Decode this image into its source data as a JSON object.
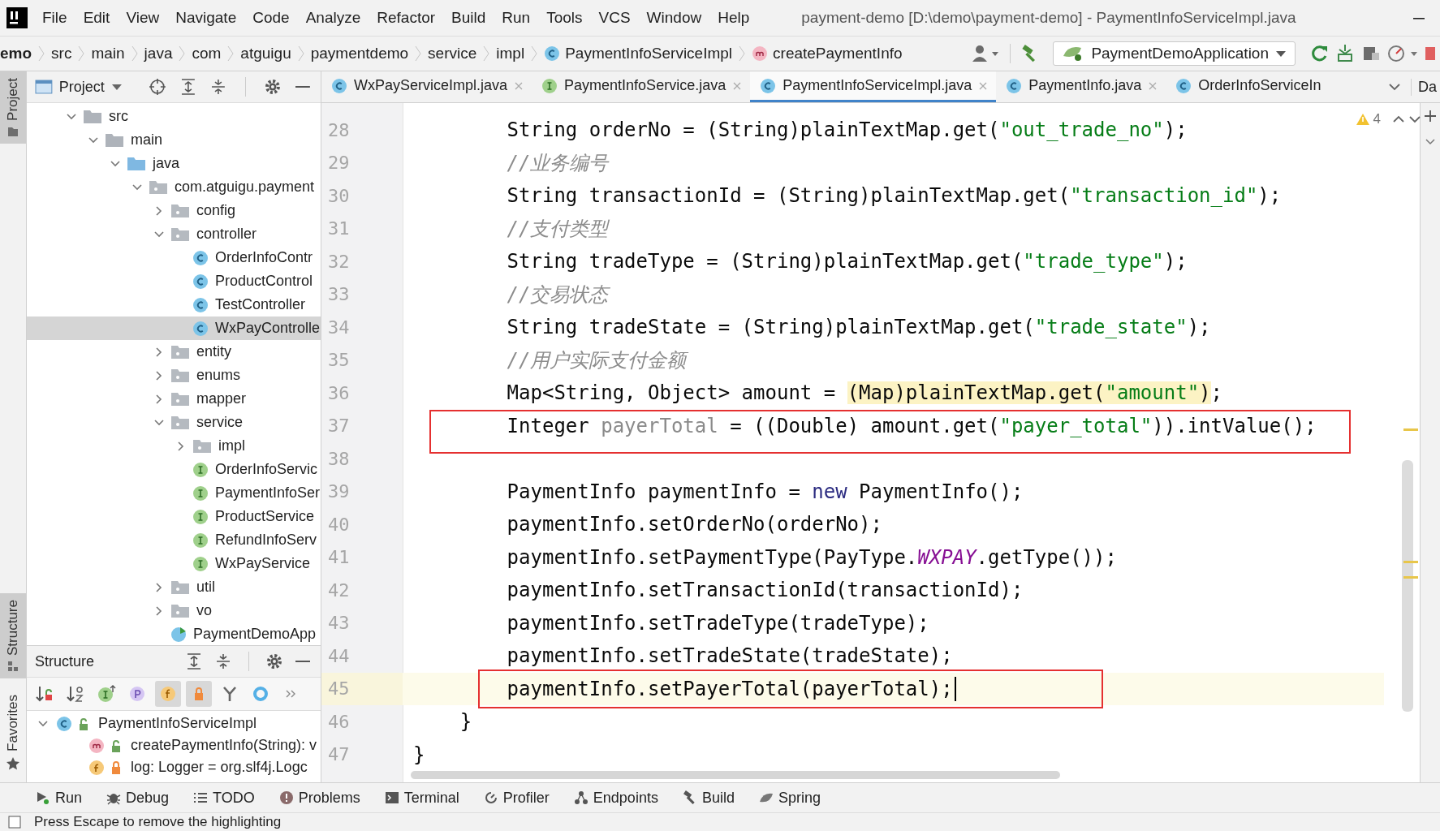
{
  "window": {
    "title": "payment-demo [D:\\demo\\payment-demo] - PaymentInfoServiceImpl.java"
  },
  "menu": [
    "File",
    "Edit",
    "View",
    "Navigate",
    "Code",
    "Analyze",
    "Refactor",
    "Build",
    "Run",
    "Tools",
    "VCS",
    "Window",
    "Help"
  ],
  "breadcrumbs": [
    {
      "label": "emo",
      "kind": "project"
    },
    {
      "label": "src",
      "kind": "dir"
    },
    {
      "label": "main",
      "kind": "dir"
    },
    {
      "label": "java",
      "kind": "dir"
    },
    {
      "label": "com",
      "kind": "dir"
    },
    {
      "label": "atguigu",
      "kind": "dir"
    },
    {
      "label": "paymentdemo",
      "kind": "dir"
    },
    {
      "label": "service",
      "kind": "dir"
    },
    {
      "label": "impl",
      "kind": "dir"
    },
    {
      "label": "PaymentInfoServiceImpl",
      "kind": "class"
    },
    {
      "label": "createPaymentInfo",
      "kind": "method"
    }
  ],
  "run_config": {
    "label": "PaymentDemoApplication"
  },
  "tool_strip": [
    {
      "label": "Project",
      "kind": "project",
      "selected": true
    },
    {
      "label": "Structure",
      "kind": "structure",
      "selected": true
    },
    {
      "label": "Favorites",
      "kind": "favorites",
      "selected": false
    }
  ],
  "project_panel": {
    "title": "Project"
  },
  "project_tree": [
    {
      "label": "src",
      "kind": "folder",
      "expanded": true,
      "selected": false,
      "children": [
        {
          "label": "main",
          "kind": "folder",
          "expanded": true,
          "selected": false,
          "children": [
            {
              "label": "java",
              "kind": "source-folder",
              "expanded": true,
              "selected": false,
              "children": [
                {
                  "label": "com.atguigu.payment",
                  "kind": "package",
                  "expanded": true,
                  "selected": false,
                  "children": [
                    {
                      "label": "config",
                      "kind": "package",
                      "expanded": false,
                      "selected": false
                    },
                    {
                      "label": "controller",
                      "kind": "package",
                      "expanded": true,
                      "selected": false,
                      "children": [
                        {
                          "label": "OrderInfoContr",
                          "kind": "class",
                          "selected": false
                        },
                        {
                          "label": "ProductControl",
                          "kind": "class",
                          "selected": false
                        },
                        {
                          "label": "TestController",
                          "kind": "class",
                          "selected": false
                        },
                        {
                          "label": "WxPayControlle",
                          "kind": "class",
                          "selected": true
                        }
                      ]
                    },
                    {
                      "label": "entity",
                      "kind": "package",
                      "expanded": false,
                      "selected": false
                    },
                    {
                      "label": "enums",
                      "kind": "package",
                      "expanded": false,
                      "selected": false
                    },
                    {
                      "label": "mapper",
                      "kind": "package",
                      "expanded": false,
                      "selected": false
                    },
                    {
                      "label": "service",
                      "kind": "package",
                      "expanded": true,
                      "selected": false,
                      "children": [
                        {
                          "label": "impl",
                          "kind": "package",
                          "expanded": false,
                          "selected": false
                        },
                        {
                          "label": "OrderInfoServic",
                          "kind": "interface",
                          "selected": false
                        },
                        {
                          "label": "PaymentInfoSer",
                          "kind": "interface",
                          "selected": false
                        },
                        {
                          "label": "ProductService",
                          "kind": "interface",
                          "selected": false
                        },
                        {
                          "label": "RefundInfoServ",
                          "kind": "interface",
                          "selected": false
                        },
                        {
                          "label": "WxPayService",
                          "kind": "interface",
                          "selected": false
                        }
                      ]
                    },
                    {
                      "label": "util",
                      "kind": "package",
                      "expanded": false,
                      "selected": false
                    },
                    {
                      "label": "vo",
                      "kind": "package",
                      "expanded": false,
                      "selected": false
                    },
                    {
                      "label": "PaymentDemoApp",
                      "kind": "app",
                      "selected": false
                    }
                  ]
                }
              ]
            }
          ]
        }
      ]
    }
  ],
  "structure": {
    "title": "Structure",
    "toolbar": [
      {
        "kind": "sort-visibility",
        "on": false
      },
      {
        "kind": "sort-alpha",
        "on": false
      },
      {
        "kind": "inherited",
        "on": false
      },
      {
        "kind": "property",
        "on": false
      },
      {
        "kind": "field",
        "on": true
      },
      {
        "kind": "lock",
        "on": true
      },
      {
        "kind": "branch",
        "on": false
      },
      {
        "kind": "ring",
        "on": false
      },
      {
        "kind": "more",
        "on": false
      }
    ],
    "tree": [
      {
        "label": "PaymentInfoServiceImpl",
        "kind": "class",
        "expanded": true,
        "children": [
          {
            "label": "createPaymentInfo(String): v",
            "kind": "method"
          },
          {
            "label": "log: Logger = org.slf4j.Logc",
            "kind": "field"
          }
        ]
      }
    ]
  },
  "editor_tabs": [
    {
      "label": "WxPayServiceImpl.java",
      "kind": "class",
      "selected": false,
      "closable": true
    },
    {
      "label": "PaymentInfoService.java",
      "kind": "interface",
      "selected": false,
      "closable": true
    },
    {
      "label": "PaymentInfoServiceImpl.java",
      "kind": "class",
      "selected": true,
      "closable": true
    },
    {
      "label": "PaymentInfo.java",
      "kind": "class",
      "selected": false,
      "closable": true
    },
    {
      "label": "OrderInfoServiceIn",
      "kind": "class",
      "selected": false,
      "closable": false
    }
  ],
  "side_tab": {
    "label": "Da"
  },
  "inspections": {
    "warnings": "4"
  },
  "code_lines": [
    {
      "number": "28",
      "current": false,
      "tokens": [
        {
          "text": "        String orderNo = (String)plainTextMap.get(",
          "kind": "plain"
        },
        {
          "text": "\"out_trade_no\"",
          "kind": "string"
        },
        {
          "text": ");",
          "kind": "plain"
        }
      ]
    },
    {
      "number": "29",
      "current": false,
      "tokens": [
        {
          "text": "        //业务编号",
          "kind": "comment"
        }
      ]
    },
    {
      "number": "30",
      "current": false,
      "tokens": [
        {
          "text": "        String transactionId = (String)plainTextMap.get(",
          "kind": "plain"
        },
        {
          "text": "\"transaction_id\"",
          "kind": "string"
        },
        {
          "text": ");",
          "kind": "plain"
        }
      ]
    },
    {
      "number": "31",
      "current": false,
      "tokens": [
        {
          "text": "        //支付类型",
          "kind": "comment"
        }
      ]
    },
    {
      "number": "32",
      "current": false,
      "tokens": [
        {
          "text": "        String tradeType = (String)plainTextMap.get(",
          "kind": "plain"
        },
        {
          "text": "\"trade_type\"",
          "kind": "string"
        },
        {
          "text": ");",
          "kind": "plain"
        }
      ]
    },
    {
      "number": "33",
      "current": false,
      "tokens": [
        {
          "text": "        //交易状态",
          "kind": "comment"
        }
      ]
    },
    {
      "number": "34",
      "current": false,
      "tokens": [
        {
          "text": "        String tradeState = (String)plainTextMap.get(",
          "kind": "plain"
        },
        {
          "text": "\"trade_state\"",
          "kind": "string"
        },
        {
          "text": ");",
          "kind": "plain"
        }
      ]
    },
    {
      "number": "35",
      "current": false,
      "tokens": [
        {
          "text": "        //用户实际支付金额",
          "kind": "comment"
        }
      ]
    },
    {
      "number": "36",
      "current": false,
      "tokens": [
        {
          "text": "        Map<String, Object> amount = ",
          "kind": "plain"
        },
        {
          "text": "(Map)plainTextMap.get(",
          "kind": "match"
        },
        {
          "text": "\"amount\"",
          "kind": "match-string"
        },
        {
          "text": ")",
          "kind": "match"
        },
        {
          "text": ";",
          "kind": "plain"
        }
      ]
    },
    {
      "number": "37",
      "current": false,
      "frame": {
        "kind": "wide"
      },
      "tokens": [
        {
          "text": "        Integer ",
          "kind": "plain"
        },
        {
          "text": "payerTotal",
          "kind": "unused"
        },
        {
          "text": " = ((Double) amount.get(",
          "kind": "plain"
        },
        {
          "text": "\"payer_total\"",
          "kind": "string"
        },
        {
          "text": ")).intValue();",
          "kind": "plain"
        }
      ]
    },
    {
      "number": "38",
      "current": false
    },
    {
      "number": "39",
      "current": false,
      "tokens": [
        {
          "text": "        PaymentInfo paymentInfo = ",
          "kind": "plain"
        },
        {
          "text": "new",
          "kind": "keyword"
        },
        {
          "text": " PaymentInfo();",
          "kind": "plain"
        }
      ]
    },
    {
      "number": "40",
      "current": false,
      "tokens": [
        {
          "text": "        paymentInfo.setOrderNo(orderNo);",
          "kind": "plain"
        }
      ]
    },
    {
      "number": "41",
      "current": false,
      "tokens": [
        {
          "text": "        paymentInfo.setPaymentType(PayType.",
          "kind": "plain"
        },
        {
          "text": "WXPAY",
          "kind": "constant"
        },
        {
          "text": ".getType());",
          "kind": "plain"
        }
      ]
    },
    {
      "number": "42",
      "current": false,
      "tokens": [
        {
          "text": "        paymentInfo.setTransactionId(transactionId);",
          "kind": "plain"
        }
      ]
    },
    {
      "number": "43",
      "current": false,
      "tokens": [
        {
          "text": "        paymentInfo.setTradeType(tradeType);",
          "kind": "plain"
        }
      ]
    },
    {
      "number": "44",
      "current": false,
      "tokens": [
        {
          "text": "        paymentInfo.setTradeState(tradeState);",
          "kind": "plain"
        }
      ]
    },
    {
      "number": "45",
      "current": true,
      "frame": {
        "kind": "tight"
      },
      "tokens": [
        {
          "text": "        paymentInfo.setPayerTotal(payerTotal);",
          "kind": "plain"
        }
      ]
    },
    {
      "number": "46",
      "current": false,
      "tokens": [
        {
          "text": "    }",
          "kind": "plain"
        }
      ]
    },
    {
      "number": "47",
      "current": false,
      "tokens": [
        {
          "text": "}",
          "kind": "plain"
        }
      ]
    }
  ],
  "tool_windows": [
    {
      "label": "Run",
      "kind": "run"
    },
    {
      "label": "Debug",
      "kind": "debug"
    },
    {
      "label": "TODO",
      "kind": "todo"
    },
    {
      "label": "Problems",
      "kind": "problems"
    },
    {
      "label": "Terminal",
      "kind": "terminal"
    },
    {
      "label": "Profiler",
      "kind": "profiler"
    },
    {
      "label": "Endpoints",
      "kind": "endpoints"
    },
    {
      "label": "Build",
      "kind": "build"
    },
    {
      "label": "Spring",
      "kind": "spring"
    }
  ],
  "status_bar": {
    "message": "Press Escape to remove the highlighting"
  }
}
